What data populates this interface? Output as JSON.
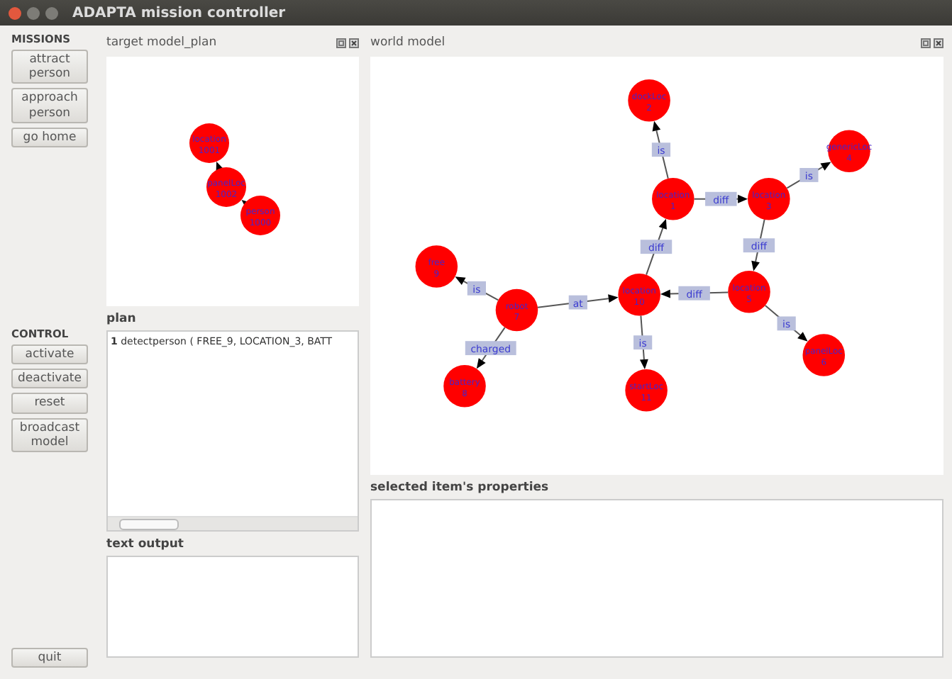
{
  "window": {
    "title": "ADAPTA mission controller"
  },
  "missions": {
    "heading": "MISSIONS",
    "buttons": [
      "attract person",
      "approach person",
      "go home"
    ]
  },
  "control": {
    "heading": "CONTROL",
    "buttons": [
      "activate",
      "deactivate",
      "reset",
      "broadcast model"
    ]
  },
  "quit_button": "quit",
  "target_model": {
    "title": "target model_plan",
    "graph": {
      "nodes": [
        {
          "label": "location",
          "id": "1001"
        },
        {
          "label": "panelLoc",
          "id": "1002"
        },
        {
          "label": "person",
          "id": "1000"
        }
      ]
    }
  },
  "plan": {
    "heading": "plan",
    "rows": [
      {
        "number": "1",
        "text": "detectperson ( FREE_9, LOCATION_3, BATT"
      }
    ]
  },
  "text_output": {
    "heading": "text output"
  },
  "world_model": {
    "title": "world model",
    "graph": {
      "nodes": [
        {
          "label": "dockLoc",
          "id": "2"
        },
        {
          "label": "location",
          "id": "1"
        },
        {
          "label": "location",
          "id": "3"
        },
        {
          "label": "genericLoc",
          "id": "4"
        },
        {
          "label": "location",
          "id": "5"
        },
        {
          "label": "panelLoc",
          "id": "6"
        },
        {
          "label": "location",
          "id": "10"
        },
        {
          "label": "startLoc",
          "id": "11"
        },
        {
          "label": "robot",
          "id": "7"
        },
        {
          "label": "free",
          "id": "9"
        },
        {
          "label": "battery",
          "id": "8"
        }
      ],
      "edges": [
        {
          "label": "is"
        },
        {
          "label": "diff"
        },
        {
          "label": "is"
        },
        {
          "label": "diff"
        },
        {
          "label": "diff"
        },
        {
          "label": "is"
        },
        {
          "label": "diff"
        },
        {
          "label": "is"
        },
        {
          "label": "at"
        },
        {
          "label": "is"
        },
        {
          "label": "charged"
        }
      ]
    }
  },
  "properties": {
    "heading": "selected item's properties"
  }
}
